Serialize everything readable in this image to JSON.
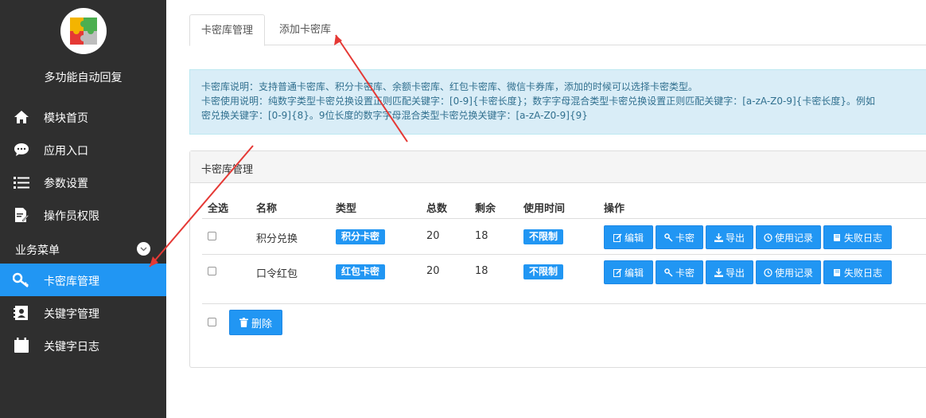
{
  "sidebar": {
    "app_name": "多功能自动回复",
    "items": [
      {
        "label": "模块首页",
        "icon": "home-icon"
      },
      {
        "label": "应用入口",
        "icon": "chat-icon"
      },
      {
        "label": "参数设置",
        "icon": "settings-list-icon"
      },
      {
        "label": "操作员权限",
        "icon": "document-edit-icon"
      }
    ],
    "section_label": "业务菜单",
    "section_items": [
      {
        "label": "卡密库管理",
        "icon": "key-icon",
        "active": true
      },
      {
        "label": "关键字管理",
        "icon": "contact-book-icon"
      },
      {
        "label": "关键字日志",
        "icon": "calendar-icon"
      }
    ]
  },
  "tabs": [
    {
      "label": "卡密库管理",
      "active": true
    },
    {
      "label": "添加卡密库",
      "active": false
    }
  ],
  "alert": {
    "line1": "卡密库说明：支持普通卡密库、积分卡密库、余额卡密库、红包卡密库、微信卡券库，添加的时候可以选择卡密类型。",
    "line2": "卡密使用说明：纯数字类型卡密兑换设置正则匹配关键字：[0-9]{卡密长度}；数字字母混合类型卡密兑换设置正则匹配关键字：[a-zA-Z0-9]{卡密长度}。例如",
    "line3": "密兑换关键字：[0-9]{8}。9位长度的数字字母混合类型卡密兑换关键字：[a-zA-Z0-9]{9}"
  },
  "panel": {
    "title": "卡密库管理",
    "columns": [
      "全选",
      "名称",
      "类型",
      "总数",
      "剩余",
      "使用时间",
      "操作"
    ],
    "rows": [
      {
        "name": "积分兑换",
        "type": "积分卡密",
        "total": "20",
        "remain": "18",
        "time": "不限制"
      },
      {
        "name": "口令红包",
        "type": "红包卡密",
        "total": "20",
        "remain": "18",
        "time": "不限制"
      }
    ],
    "actions": [
      "编辑",
      "卡密",
      "导出",
      "使用记录",
      "失败日志"
    ],
    "delete_label": "删除"
  },
  "colors": {
    "sidebar_bg": "#2f2f2f",
    "accent": "#2196f3",
    "alert_bg": "#d9edf7",
    "alert_text": "#31708f",
    "arrow": "#e53935"
  }
}
